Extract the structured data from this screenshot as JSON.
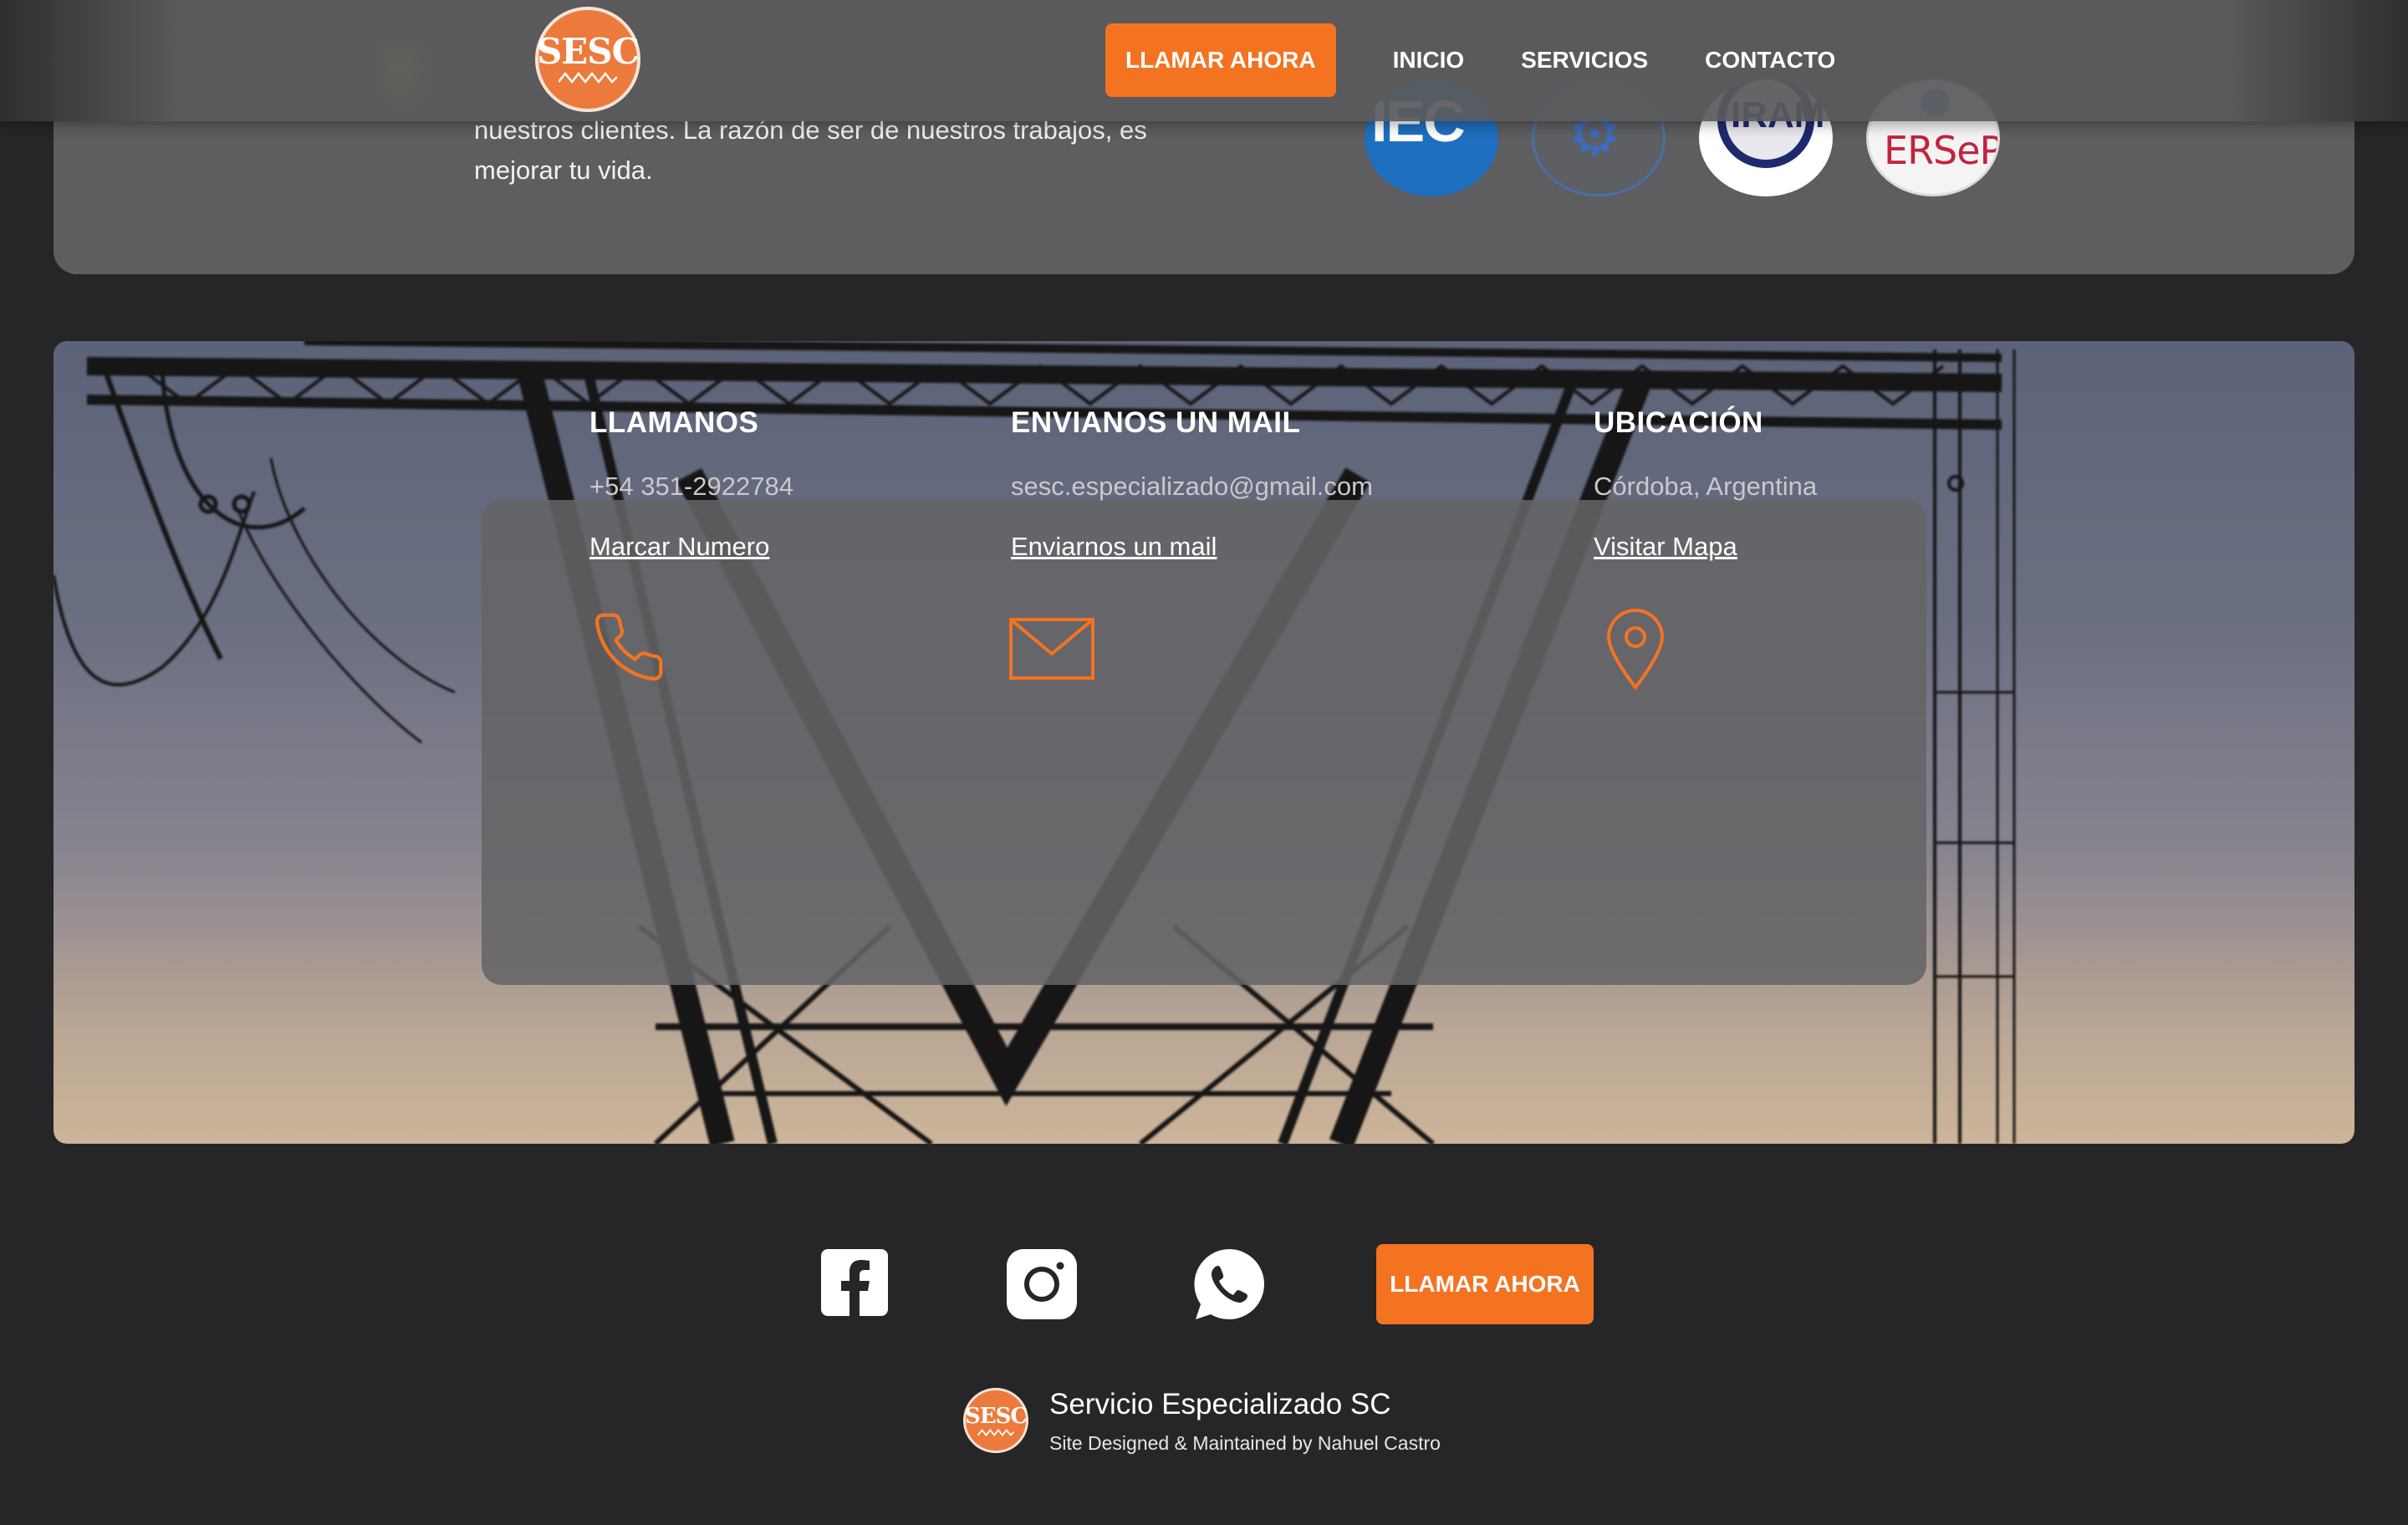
{
  "colors": {
    "accent": "#f47321",
    "background": "#262628",
    "header": "#5a5a5c",
    "card": "#646466"
  },
  "header": {
    "logo_text": "SESC",
    "call_button": "LLAMAR AHORA",
    "nav": [
      "INICIO",
      "SERVICIOS",
      "CONTACTO"
    ]
  },
  "about": {
    "text": "nuestros clientes. La razón de ser de nuestros trabajos, es mejorar tu vida.",
    "certifications": [
      {
        "name": "iec-logo-icon",
        "text": "IEC"
      },
      {
        "name": "gear-logo-icon",
        "text": "⚙"
      },
      {
        "name": "iram-logo-icon",
        "text": "IRAM"
      },
      {
        "name": "ersep-logo-icon",
        "text": "ERSeP"
      }
    ]
  },
  "contact": {
    "columns": [
      {
        "icon": "phone-icon",
        "title": "LLAMANOS",
        "value": "+54 351-2922784",
        "link": "Marcar Numero"
      },
      {
        "icon": "mail-icon",
        "title": "ENVIANOS UN MAIL",
        "value": "sesc.especializado@gmail.com",
        "link": "Enviarnos un mail"
      },
      {
        "icon": "location-pin-icon",
        "title": "UBICACIÓN",
        "value": "Córdoba, Argentina",
        "link": "Visitar Mapa"
      }
    ]
  },
  "footer": {
    "social": [
      "facebook-icon",
      "instagram-icon",
      "whatsapp-icon"
    ],
    "call_button": "LLAMAR AHORA",
    "logo_text": "SESC",
    "site_name": "Servicio Especializado SC",
    "credit": "Site Designed & Maintained by Nahuel Castro"
  }
}
